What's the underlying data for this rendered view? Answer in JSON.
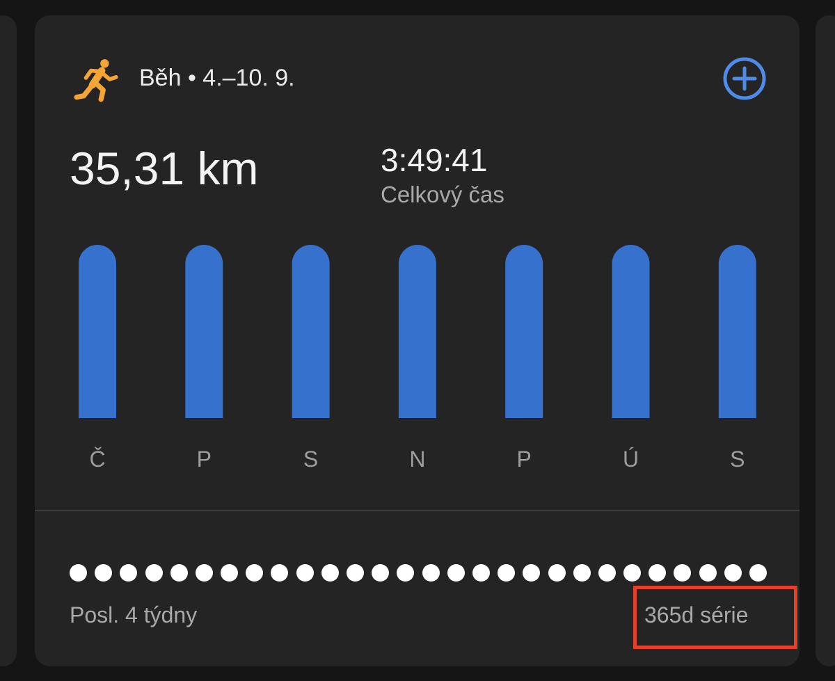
{
  "header": {
    "icon": "running-person-icon",
    "title": "Běh • 4.–10. 9.",
    "add_icon": "plus-circle-icon"
  },
  "summary": {
    "distance": "35,31 km",
    "duration_value": "3:49:41",
    "duration_label": "Celkový čas"
  },
  "chart_data": {
    "type": "bar",
    "categories": [
      "Č",
      "P",
      "S",
      "N",
      "P",
      "Ú",
      "S"
    ],
    "values": [
      1,
      1,
      1,
      1,
      1,
      1,
      1
    ],
    "ylim": [
      0,
      1
    ],
    "grid": false
  },
  "streak": {
    "dots_total": 28,
    "dots_filled": 28
  },
  "footer": {
    "left": "Posl. 4 týdny",
    "right": "365d série"
  },
  "colors": {
    "card_background": "#242424",
    "page_background": "#151515",
    "bar": "#3571cd",
    "run_icon": "#f5a534",
    "accent": "#4f8ce8",
    "highlight_border": "#e4412a"
  }
}
